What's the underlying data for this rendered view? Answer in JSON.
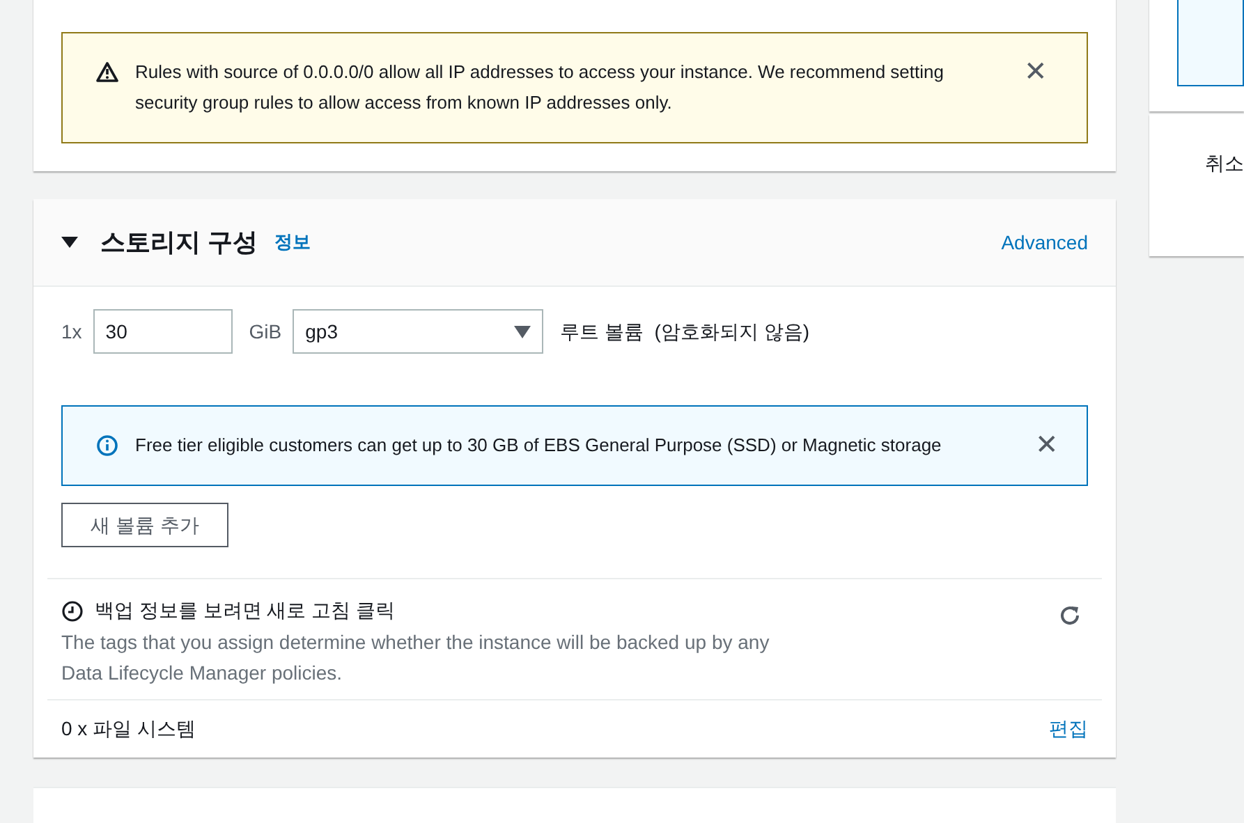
{
  "network_card": {
    "warning": {
      "kind": "warning",
      "message": "Rules with source of 0.0.0.0/0 allow all IP addresses to access your instance. We recommend setting security group rules to allow access from known IP addresses only.",
      "dismiss": "✕"
    }
  },
  "storage_card": {
    "title": "스토리지 구성",
    "expanded": true,
    "info_link": "정보",
    "advanced_link": "Advanced",
    "volume": {
      "count": "1x",
      "size": "30",
      "unit": "GiB",
      "type": "gp3",
      "description": "루트 볼륨  (암호화되지 않음)"
    },
    "notice": {
      "kind": "info",
      "message": "Free tier eligible customers can get up to 30 GB of EBS General Purpose (SSD) or Magnetic storage",
      "dismiss": "✕"
    },
    "add_volume_button": "새 볼륨 추가",
    "backup": {
      "title": "백업 정보를 보려면 새로 고침 클릭",
      "description": "The tags that you assign determine whether the instance will be backed up by any Data Lifecycle Manager policies."
    },
    "file_systems": {
      "label": "0 x 파일 시스템",
      "edit_link": "편집"
    }
  },
  "summary_panel": {
    "cancel_button": "취소"
  }
}
